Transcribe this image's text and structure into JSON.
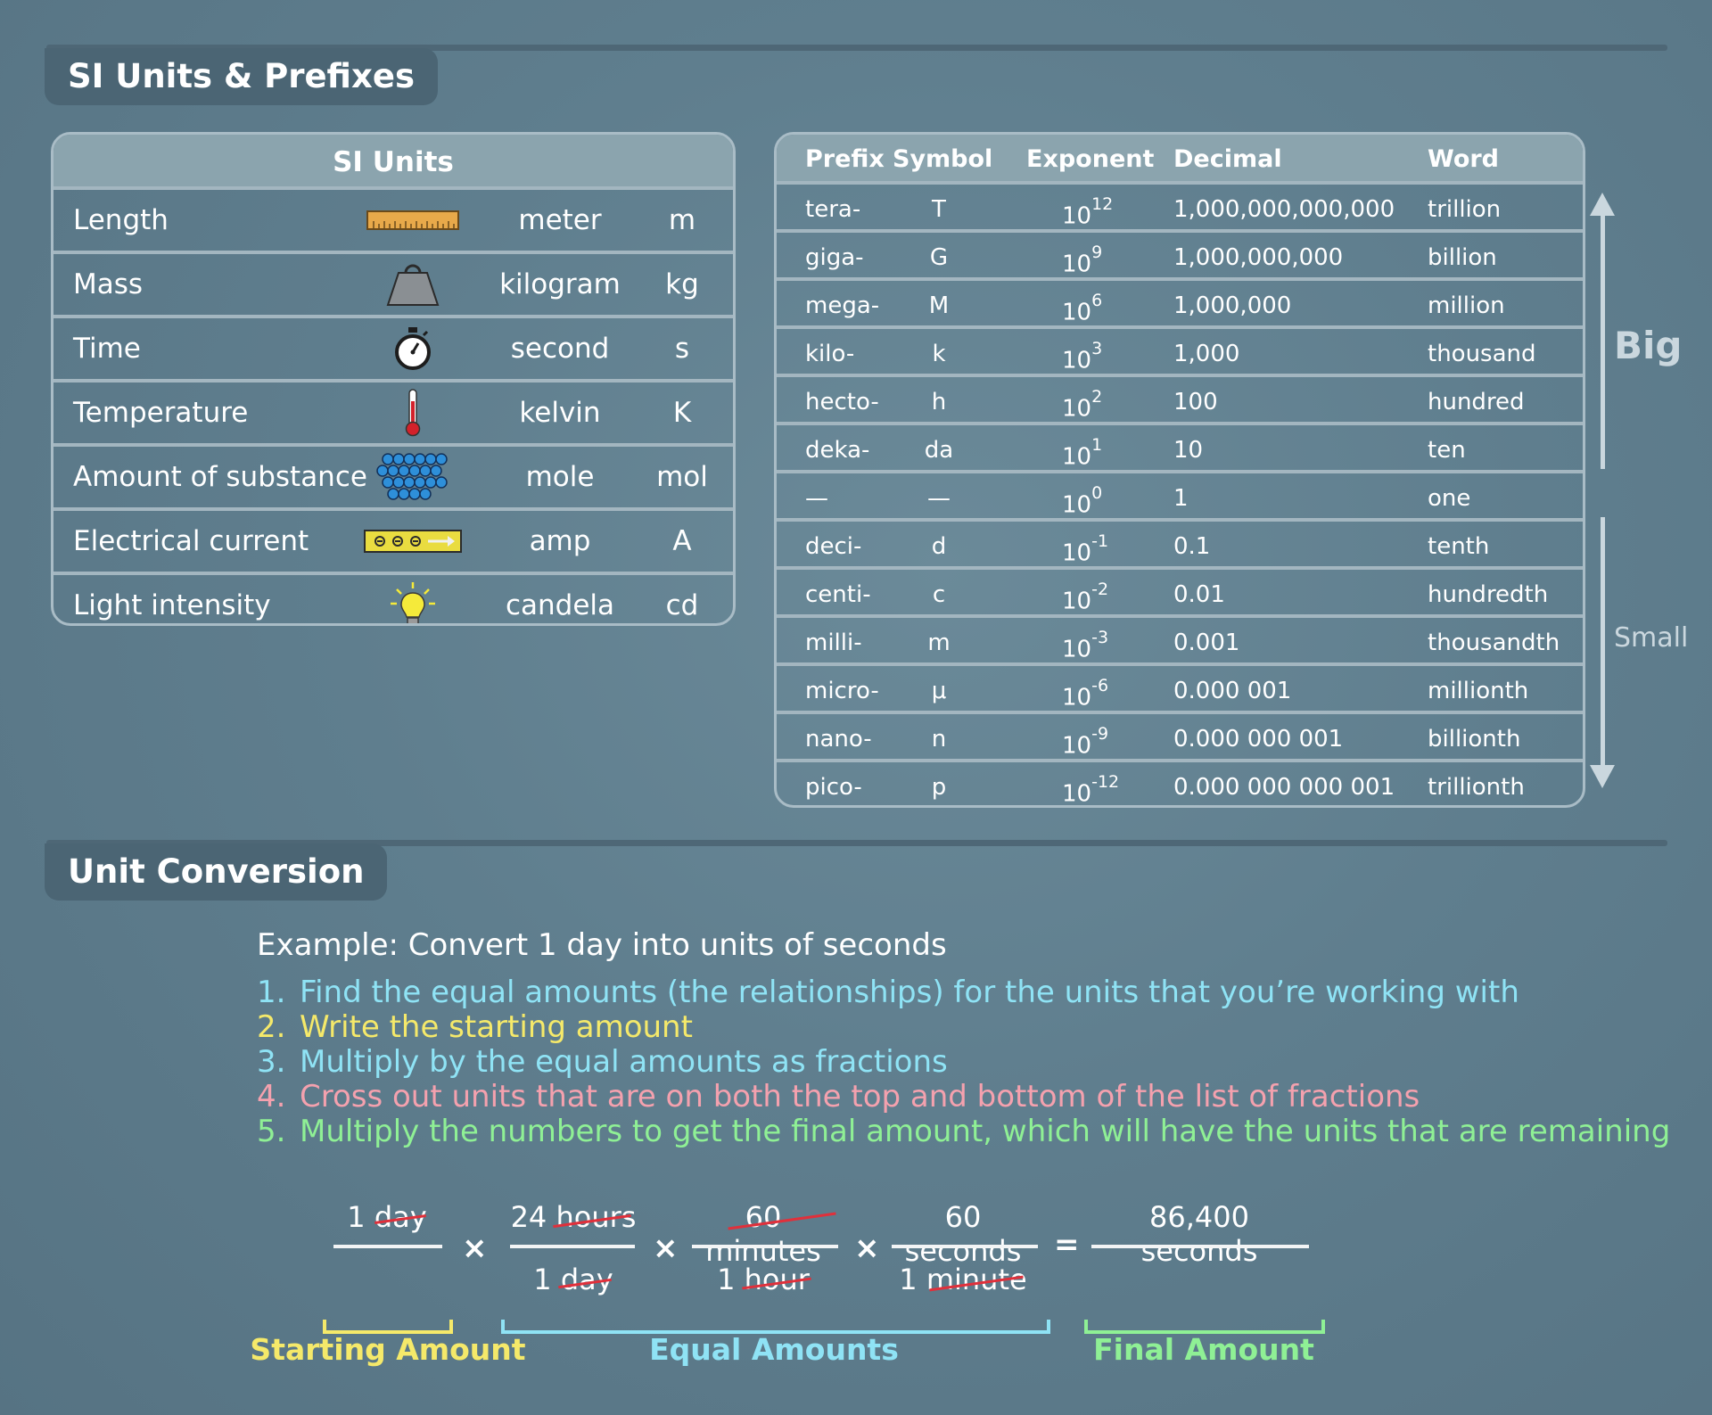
{
  "colors": {
    "cyan": "#8fe3f5",
    "yellow": "#f5e96a",
    "pink": "#f4a1ae",
    "green": "#8ff095",
    "strike": "#e0303b"
  },
  "si_section": {
    "title": "SI Units & Prefixes"
  },
  "si_units": {
    "header": "SI Units",
    "rows": [
      {
        "quantity": "Length",
        "icon": "ruler-icon",
        "unit": "meter",
        "symbol": "m"
      },
      {
        "quantity": "Mass",
        "icon": "weight-icon",
        "unit": "kilogram",
        "symbol": "kg"
      },
      {
        "quantity": "Time",
        "icon": "stopwatch-icon",
        "unit": "second",
        "symbol": "s"
      },
      {
        "quantity": "Temperature",
        "icon": "thermometer-icon",
        "unit": "kelvin",
        "symbol": "K"
      },
      {
        "quantity": "Amount of substance",
        "icon": "molecules-icon",
        "unit": "mole",
        "symbol": "mol"
      },
      {
        "quantity": "Electrical current",
        "icon": "current-icon",
        "unit": "amp",
        "symbol": "A"
      },
      {
        "quantity": "Light intensity",
        "icon": "light-bulb-icon",
        "unit": "candela",
        "symbol": "cd"
      }
    ]
  },
  "prefixes": {
    "headers": {
      "prefix": "Prefix",
      "symbol": "Symbol",
      "exponent": "Exponent",
      "decimal": "Decimal",
      "word": "Word"
    },
    "rows": [
      {
        "prefix": "tera-",
        "symbol": "T",
        "base": "10",
        "exp": "12",
        "decimal": "1,000,000,000,000",
        "word": "trillion"
      },
      {
        "prefix": "giga-",
        "symbol": "G",
        "base": "10",
        "exp": "9",
        "decimal": "1,000,000,000",
        "word": "billion"
      },
      {
        "prefix": "mega-",
        "symbol": "M",
        "base": "10",
        "exp": "6",
        "decimal": "1,000,000",
        "word": "million"
      },
      {
        "prefix": "kilo-",
        "symbol": "k",
        "base": "10",
        "exp": "3",
        "decimal": "1,000",
        "word": "thousand"
      },
      {
        "prefix": "hecto-",
        "symbol": "h",
        "base": "10",
        "exp": "2",
        "decimal": "100",
        "word": "hundred"
      },
      {
        "prefix": "deka-",
        "symbol": "da",
        "base": "10",
        "exp": "1",
        "decimal": "10",
        "word": "ten"
      },
      {
        "prefix": "—",
        "symbol": "—",
        "base": "10",
        "exp": "0",
        "decimal": "1",
        "word": "one"
      },
      {
        "prefix": "deci-",
        "symbol": "d",
        "base": "10",
        "exp": "-1",
        "decimal": "0.1",
        "word": "tenth"
      },
      {
        "prefix": "centi-",
        "symbol": "c",
        "base": "10",
        "exp": "-2",
        "decimal": "0.01",
        "word": "hundredth"
      },
      {
        "prefix": "milli-",
        "symbol": "m",
        "base": "10",
        "exp": "-3",
        "decimal": "0.001",
        "word": "thousandth"
      },
      {
        "prefix": "micro-",
        "symbol": "μ",
        "base": "10",
        "exp": "-6",
        "decimal": "0.000 001",
        "word": "millionth"
      },
      {
        "prefix": "nano-",
        "symbol": "n",
        "base": "10",
        "exp": "-9",
        "decimal": "0.000 000 001",
        "word": "billionth"
      },
      {
        "prefix": "pico-",
        "symbol": "p",
        "base": "10",
        "exp": "-12",
        "decimal": "0.000 000 000 001",
        "word": "trillionth"
      }
    ],
    "scale_big": "Big",
    "scale_small": "Small"
  },
  "conversion_section": {
    "title": "Unit Conversion",
    "example": "Example: Convert 1 day into units of seconds",
    "steps": [
      {
        "num": "1.",
        "text": "Find the equal amounts (the relationships) for the units that you’re working with"
      },
      {
        "num": "2.",
        "text": "Write the starting amount"
      },
      {
        "num": "3.",
        "text": "Multiply by the equal amounts as fractions"
      },
      {
        "num": "4.",
        "text": "Cross out units that are on both the top and bottom of the list of fractions"
      },
      {
        "num": "5.",
        "text": "Multiply the numbers to get the final amount, which will have the units that are remaining"
      }
    ]
  },
  "equation": {
    "start_top": "1 day",
    "f1_top": "24 hours",
    "f1_bottom": "1 day",
    "f2_top": "60 minutes",
    "f2_bottom": "1 hour",
    "f3_top": "60 seconds",
    "f3_bottom": "1 minute",
    "result": "86,400 seconds",
    "times": "×",
    "equals": "="
  },
  "labels": {
    "starting": "Starting Amount",
    "equal": "Equal Amounts",
    "final": "Final Amount"
  }
}
